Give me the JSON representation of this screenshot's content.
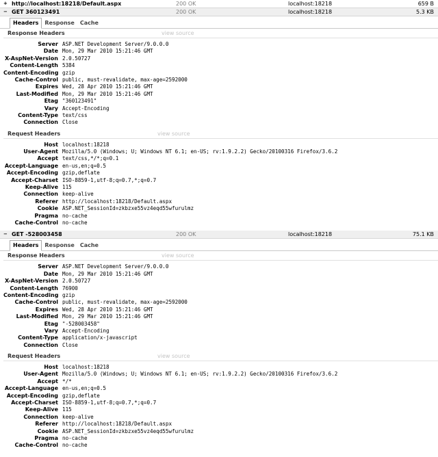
{
  "top_request": {
    "url": "http://localhost:18218/Default.aspx",
    "status": "200 OK",
    "domain": "localhost:18218",
    "size": "659 B"
  },
  "requests": [
    {
      "url": "GET 360123491",
      "status": "200 OK",
      "domain": "localhost:18218",
      "size": "5.3 KB",
      "tabs": [
        "Headers",
        "Response",
        "Cache"
      ],
      "response_title": "Response Headers",
      "view_source": "view source",
      "response_headers": [
        {
          "k": "Server",
          "v": "ASP.NET Development Server/9.0.0.0"
        },
        {
          "k": "Date",
          "v": "Mon, 29 Mar 2010 15:21:46 GMT"
        },
        {
          "k": "X-AspNet-Version",
          "v": "2.0.50727"
        },
        {
          "k": "Content-Length",
          "v": "5384"
        },
        {
          "k": "Content-Encoding",
          "v": "gzip"
        },
        {
          "k": "Cache-Control",
          "v": "public, must-revalidate, max-age=2592000"
        },
        {
          "k": "Expires",
          "v": "Wed, 28 Apr 2010 15:21:46 GMT"
        },
        {
          "k": "Last-Modified",
          "v": "Mon, 29 Mar 2010 15:21:46 GMT"
        },
        {
          "k": "Etag",
          "v": "\"360123491\""
        },
        {
          "k": "Vary",
          "v": "Accept-Encoding"
        },
        {
          "k": "Content-Type",
          "v": "text/css"
        },
        {
          "k": "Connection",
          "v": "Close"
        }
      ],
      "request_title": "Request Headers",
      "request_headers": [
        {
          "k": "Host",
          "v": "localhost:18218"
        },
        {
          "k": "User-Agent",
          "v": "Mozilla/5.0 (Windows; U; Windows NT 6.1; en-US; rv:1.9.2.2) Gecko/20100316 Firefox/3.6.2"
        },
        {
          "k": "Accept",
          "v": "text/css,*/*;q=0.1"
        },
        {
          "k": "Accept-Language",
          "v": "en-us,en;q=0.5"
        },
        {
          "k": "Accept-Encoding",
          "v": "gzip,deflate"
        },
        {
          "k": "Accept-Charset",
          "v": "ISO-8859-1,utf-8;q=0.7,*;q=0.7"
        },
        {
          "k": "Keep-Alive",
          "v": "115"
        },
        {
          "k": "Connection",
          "v": "keep-alive"
        },
        {
          "k": "Referer",
          "v": "http://localhost:18218/Default.aspx"
        },
        {
          "k": "Cookie",
          "v": "ASP.NET_SessionId=zkbzxe55vz4eqd55wfurulmz"
        },
        {
          "k": "Pragma",
          "v": "no-cache"
        },
        {
          "k": "Cache-Control",
          "v": "no-cache"
        }
      ]
    },
    {
      "url": "GET -528003458",
      "status": "200 OK",
      "domain": "localhost:18218",
      "size": "75.1 KB",
      "tabs": [
        "Headers",
        "Response",
        "Cache"
      ],
      "response_title": "Response Headers",
      "view_source": "view source",
      "response_headers": [
        {
          "k": "Server",
          "v": "ASP.NET Development Server/9.0.0.0"
        },
        {
          "k": "Date",
          "v": "Mon, 29 Mar 2010 15:21:46 GMT"
        },
        {
          "k": "X-AspNet-Version",
          "v": "2.0.50727"
        },
        {
          "k": "Content-Length",
          "v": "76900"
        },
        {
          "k": "Content-Encoding",
          "v": "gzip"
        },
        {
          "k": "Cache-Control",
          "v": "public, must-revalidate, max-age=2592000"
        },
        {
          "k": "Expires",
          "v": "Wed, 28 Apr 2010 15:21:46 GMT"
        },
        {
          "k": "Last-Modified",
          "v": "Mon, 29 Mar 2010 15:21:46 GMT"
        },
        {
          "k": "Etag",
          "v": "\"-528003458\""
        },
        {
          "k": "Vary",
          "v": "Accept-Encoding"
        },
        {
          "k": "Content-Type",
          "v": "application/x-javascript"
        },
        {
          "k": "Connection",
          "v": "Close"
        }
      ],
      "request_title": "Request Headers",
      "request_headers": [
        {
          "k": "Host",
          "v": "localhost:18218"
        },
        {
          "k": "User-Agent",
          "v": "Mozilla/5.0 (Windows; U; Windows NT 6.1; en-US; rv:1.9.2.2) Gecko/20100316 Firefox/3.6.2"
        },
        {
          "k": "Accept",
          "v": "*/*"
        },
        {
          "k": "Accept-Language",
          "v": "en-us,en;q=0.5"
        },
        {
          "k": "Accept-Encoding",
          "v": "gzip,deflate"
        },
        {
          "k": "Accept-Charset",
          "v": "ISO-8859-1,utf-8;q=0.7,*;q=0.7"
        },
        {
          "k": "Keep-Alive",
          "v": "115"
        },
        {
          "k": "Connection",
          "v": "keep-alive"
        },
        {
          "k": "Referer",
          "v": "http://localhost:18218/Default.aspx"
        },
        {
          "k": "Cookie",
          "v": "ASP.NET_SessionId=zkbzxe55vz4eqd55wfurulmz"
        },
        {
          "k": "Pragma",
          "v": "no-cache"
        },
        {
          "k": "Cache-Control",
          "v": "no-cache"
        }
      ]
    }
  ]
}
